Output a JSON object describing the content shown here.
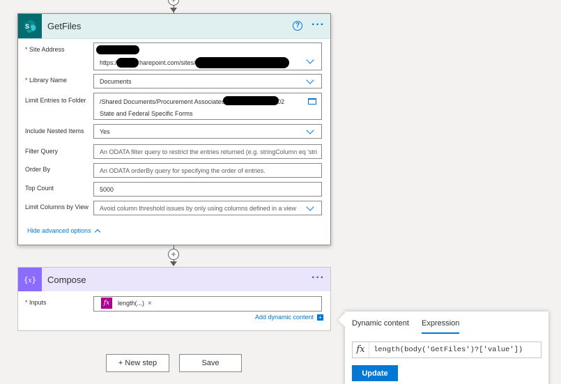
{
  "getfiles": {
    "title": "GetFiles",
    "fields": {
      "site_address": {
        "label": "Site Address",
        "value": "https://",
        "value_tail": "harepoint.com/sites/"
      },
      "library_name": {
        "label": "Library Name",
        "value": "Documents"
      },
      "limit_folder": {
        "label": "Limit Entries to Folder",
        "line1": "/Shared Documents/Procurement Associates",
        "line1_tail": "02",
        "line2": "State and Federal Specific Forms"
      },
      "include_nested": {
        "label": "Include Nested Items",
        "value": "Yes"
      },
      "filter_query": {
        "label": "Filter Query",
        "placeholder": "An ODATA filter query to restrict the entries returned (e.g. stringColumn eq 'stri"
      },
      "order_by": {
        "label": "Order By",
        "placeholder": "An ODATA orderBy query for specifying the order of entries."
      },
      "top_count": {
        "label": "Top Count",
        "value": "5000"
      },
      "limit_columns": {
        "label": "Limit Columns by View",
        "placeholder": "Avoid column threshold issues by only using columns defined in a view"
      }
    },
    "hide_advanced": "Hide advanced options"
  },
  "compose": {
    "title": "Compose",
    "inputs_label": "Inputs",
    "token_label": "length(...)",
    "token_remove": "×",
    "add_dynamic": "Add dynamic content",
    "add_dynamic_icon": "+"
  },
  "buttons": {
    "new_step": "+ New step",
    "save": "Save"
  },
  "panel": {
    "tab_dynamic": "Dynamic content",
    "tab_expression": "Expression",
    "fx": "fx",
    "expression": "length(body('GetFiles')?['value'])",
    "update": "Update"
  },
  "glyphs": {
    "plus": "+",
    "help": "?",
    "more": "···",
    "required": "*"
  },
  "colors": {
    "sharepoint": "#036c70",
    "compose": "#8c6cff",
    "accent": "#0078d4",
    "token": "#ad008c"
  }
}
